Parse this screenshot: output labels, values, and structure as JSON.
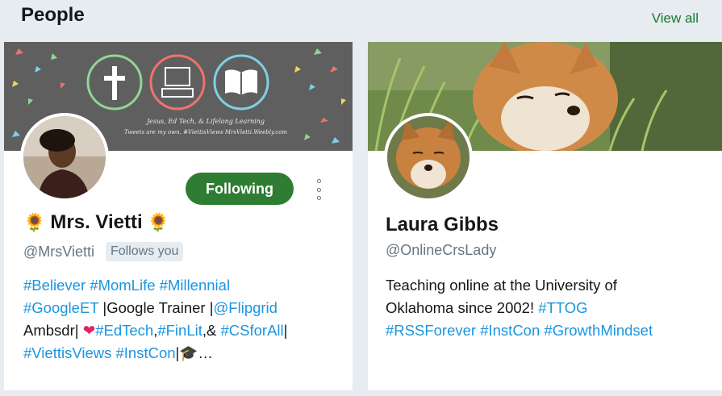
{
  "header": {
    "title": "People",
    "view_all": "View all"
  },
  "cards": [
    {
      "name": "Mrs. Vietti",
      "name_emoji": "🌻",
      "handle": "@MrsVietti",
      "follows_you": "Follows you",
      "follow_button": "Following",
      "banner": {
        "tagline_1": "Jesus, Ed Tech, & Lifelong Learning",
        "tagline_2": "Tweets are my own. #ViettisViews MrsVietti.Weebly.com"
      },
      "bio": {
        "line1": [
          {
            "t": "#Believer",
            "tag": true
          },
          {
            "t": " "
          },
          {
            "t": "#MomLife",
            "tag": true
          },
          {
            "t": " "
          },
          {
            "t": "#Millennial",
            "tag": true
          }
        ],
        "line2": [
          {
            "t": "#GoogleET",
            "tag": true
          },
          {
            "t": " |Google Trainer |"
          },
          {
            "t": "@Flipgrid",
            "tag": true
          }
        ],
        "line3": [
          {
            "t": "Ambsdr| "
          },
          {
            "t": "❤",
            "heart": true
          },
          {
            "t": "#EdTech",
            "tag": true
          },
          {
            "t": ","
          },
          {
            "t": "#FinLit",
            "tag": true
          },
          {
            "t": ",& "
          },
          {
            "t": "#CSforAll",
            "tag": true
          },
          {
            "t": "|"
          }
        ],
        "line4": [
          {
            "t": "#ViettisViews",
            "tag": true
          },
          {
            "t": " "
          },
          {
            "t": "#InstCon",
            "tag": true
          },
          {
            "t": "|🎓…"
          }
        ]
      }
    },
    {
      "name": "Laura Gibbs",
      "handle": "@OnlineCrsLady",
      "bio": {
        "line1": [
          {
            "t": "Teaching online at the University of"
          }
        ],
        "line2": [
          {
            "t": "Oklahoma since 2002! "
          },
          {
            "t": "#TTOG",
            "tag": true
          }
        ],
        "line3": [
          {
            "t": "#RSSForever",
            "tag": true
          },
          {
            "t": " "
          },
          {
            "t": "#InstCon",
            "tag": true
          },
          {
            "t": " "
          },
          {
            "t": "#GrowthMindset",
            "tag": true
          }
        ]
      }
    }
  ],
  "colors": {
    "background": "#e6ecf0",
    "follow_green": "#2e7d32",
    "link_blue": "#1b95e0",
    "view_all_green": "#1a7a2c",
    "heart_red": "#e0245e"
  },
  "icons": [
    "cross-icon",
    "computer-icon",
    "book-icon",
    "more-icon",
    "heart-icon",
    "graduation-cap-icon",
    "sunflower-icon"
  ]
}
